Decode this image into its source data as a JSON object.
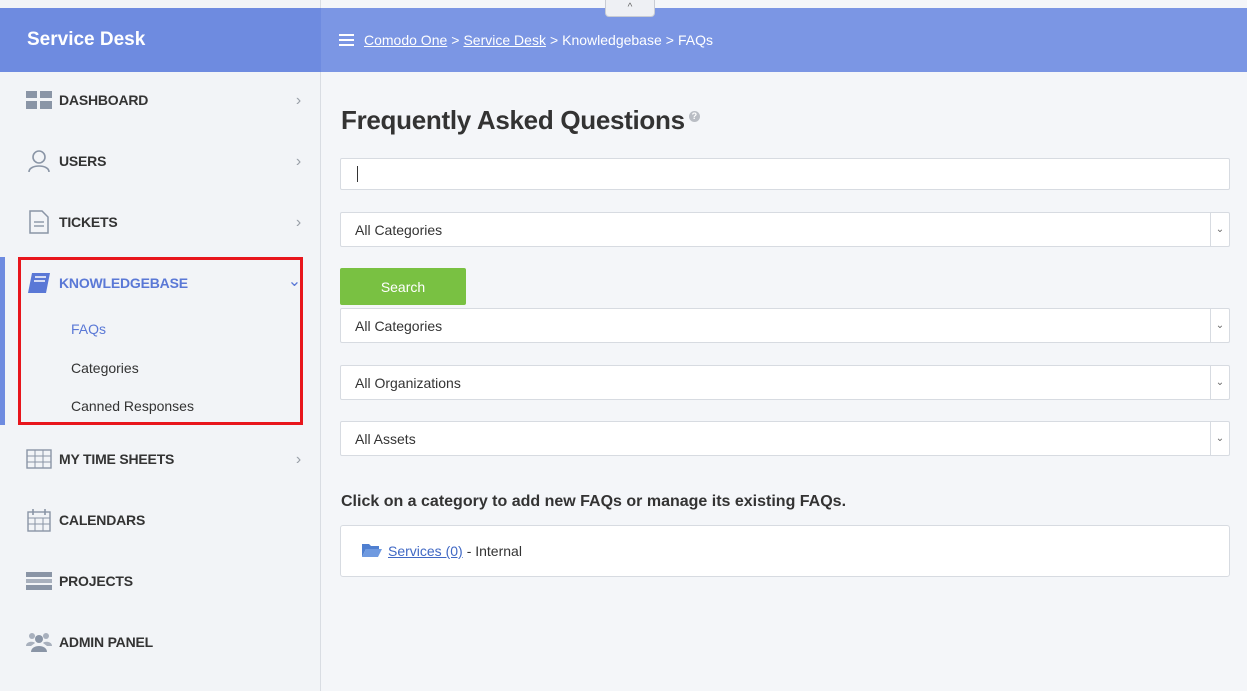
{
  "sidebar": {
    "title": "Service Desk",
    "items": [
      {
        "label": "DASHBOARD",
        "icon": "dashboard-icon",
        "chevron": "›"
      },
      {
        "label": "USERS",
        "icon": "user-icon",
        "chevron": "›"
      },
      {
        "label": "TICKETS",
        "icon": "document-icon",
        "chevron": "›"
      },
      {
        "label": "KNOWLEDGEBASE",
        "icon": "book-icon",
        "chevron": "⌄"
      },
      {
        "label": "MY TIME SHEETS",
        "icon": "grid-table-icon",
        "chevron": "›"
      },
      {
        "label": "CALENDARS",
        "icon": "calendar-icon"
      },
      {
        "label": "PROJECTS",
        "icon": "projects-icon"
      },
      {
        "label": "ADMIN PANEL",
        "icon": "admin-users-icon"
      }
    ],
    "subitems": [
      "FAQs",
      "Categories",
      "Canned Responses"
    ]
  },
  "topbar": {
    "collapse_glyph": "^",
    "breadcrumb": [
      "Comodo One",
      "Service Desk",
      "Knowledgebase",
      "FAQs"
    ],
    "separator": ">"
  },
  "main": {
    "title": "Frequently Asked Questions",
    "help_glyph": "?",
    "search_value": "",
    "filter_category": "All Categories",
    "search_button": "Search",
    "filters": [
      "All Categories",
      "All Organizations",
      "All Assets"
    ],
    "hint": "Click on a category to add new FAQs or manage its existing FAQs.",
    "category": {
      "name": "Services (0)",
      "suffix": "- Internal"
    }
  },
  "colors": {
    "header_blue": "#6e8be0",
    "accent_blue": "#5a78d6",
    "search_green": "#79c142",
    "highlight_red": "#e8151c"
  }
}
